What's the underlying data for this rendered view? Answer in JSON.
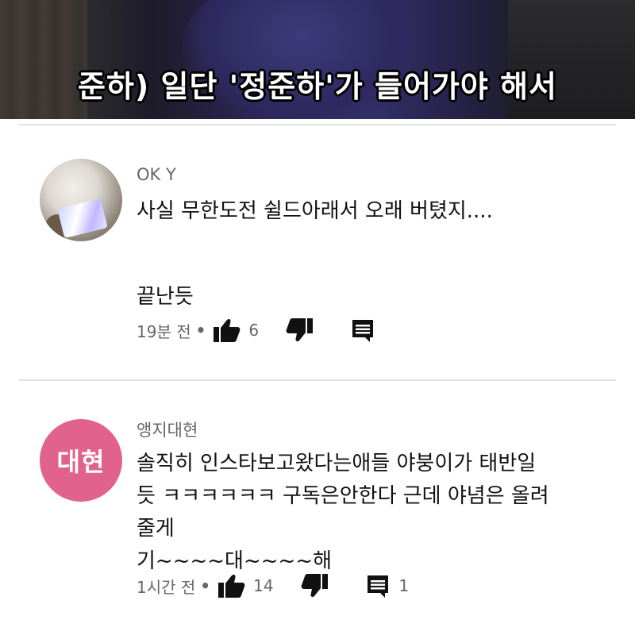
{
  "video": {
    "subtitle": "준하) 일단 '정준하'가 들어가야 해서"
  },
  "comments": [
    {
      "author": "OK Y",
      "text_lines": [
        "사실 무한도전 쉴드아래서 오래 버텼지....",
        "끝난듯"
      ],
      "time": "19분 전",
      "likes": "6",
      "replies": ""
    },
    {
      "author": "앵지대현",
      "avatar_text": "대현",
      "avatar_color": "#e1638d",
      "text_lines": [
        "솔직히 인스타보고왔다는애들 야붕이가 태반일",
        "듯 ㅋㅋㅋㅋㅋㅋ 구독은안한다 근데 야념은 올려",
        "줄게",
        "기~~~~대~~~~해"
      ],
      "time": "1시간 전",
      "likes": "14",
      "replies": "1"
    }
  ],
  "icons": {
    "like": "thumbs-up-icon",
    "dislike": "thumbs-down-icon",
    "reply": "comment-icon"
  },
  "separator": "•"
}
